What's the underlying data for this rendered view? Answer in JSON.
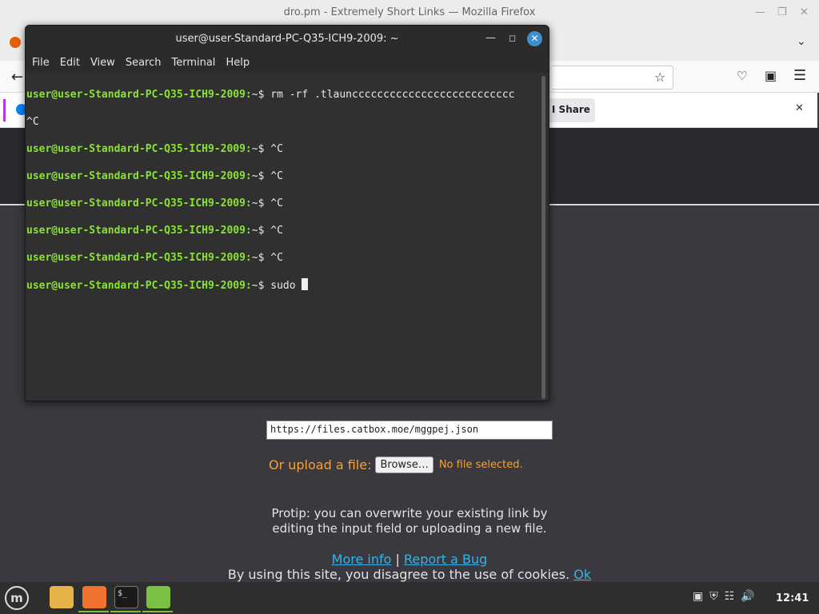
{
  "firefox": {
    "window_title": "dro.pm - Extremely Short Links — Mozilla Firefox",
    "notification_button": "t I Share"
  },
  "page": {
    "link_value": "https://files.catbox.moe/mggpej.json",
    "upload_label": "Or upload a file:",
    "browse_label": "Browse…",
    "no_file": "No file selected.",
    "protip_line1": "Protip: you can overwrite your existing link by",
    "protip_line2": "editing the input field or uploading a new file.",
    "more_info": "More info",
    "separator": "|",
    "report_bug": "Report a Bug",
    "cookie_text": "By using this site, you disagree to the use of cookies.",
    "cookie_ok": "Ok"
  },
  "terminal": {
    "title": "user@user-Standard-PC-Q35-ICH9-2009: ~",
    "menu": [
      "File",
      "Edit",
      "View",
      "Search",
      "Terminal",
      "Help"
    ],
    "lines": [
      {
        "prompt": "user@user-Standard-PC-Q35-ICH9-2009:",
        "path": "~$",
        "cmd": " rm -rf .tlauncccccccccccccccccccccccccc"
      },
      {
        "prompt": "",
        "path": "",
        "cmd": "^C"
      },
      {
        "prompt": "user@user-Standard-PC-Q35-ICH9-2009:",
        "path": "~$",
        "cmd": " ^C"
      },
      {
        "prompt": "user@user-Standard-PC-Q35-ICH9-2009:",
        "path": "~$",
        "cmd": " ^C"
      },
      {
        "prompt": "user@user-Standard-PC-Q35-ICH9-2009:",
        "path": "~$",
        "cmd": " ^C"
      },
      {
        "prompt": "user@user-Standard-PC-Q35-ICH9-2009:",
        "path": "~$",
        "cmd": " ^C"
      },
      {
        "prompt": "user@user-Standard-PC-Q35-ICH9-2009:",
        "path": "~$",
        "cmd": " ^C"
      },
      {
        "prompt": "user@user-Standard-PC-Q35-ICH9-2009:",
        "path": "~$",
        "cmd": " sudo "
      }
    ]
  },
  "taskbar": {
    "clock": "12:41",
    "apps": [
      "files-icon",
      "firefox-icon",
      "terminal-icon",
      "mint-update-icon"
    ]
  },
  "colors": {
    "prompt_green": "#8ae234",
    "link_blue": "#35b3e8",
    "upload_orange": "#f2a33a",
    "mint_green": "#7ac143"
  }
}
